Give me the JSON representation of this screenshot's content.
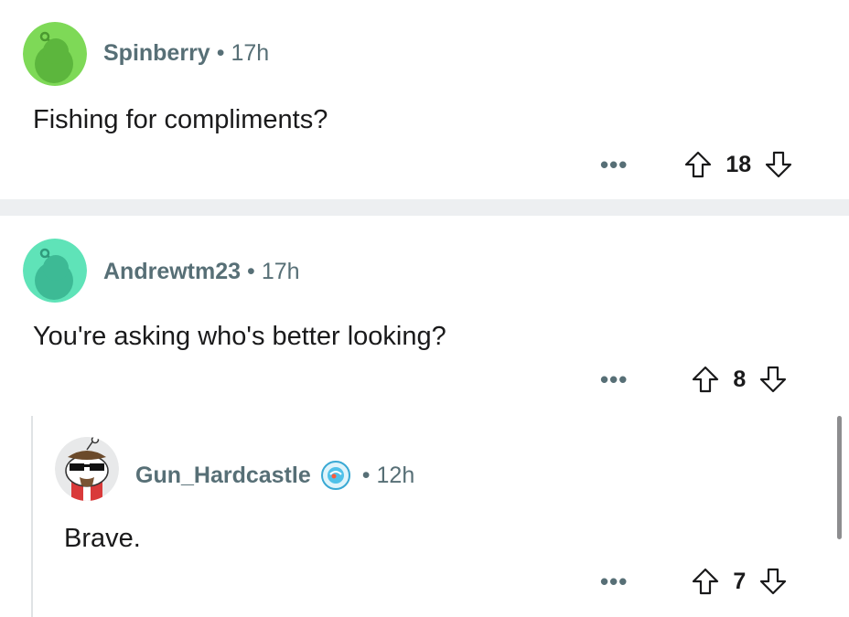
{
  "comments": [
    {
      "username": "Spinberry",
      "separator": "•",
      "time": "17h",
      "body": "Fishing for compliments?",
      "more": "•••",
      "score": "18",
      "avatar_color": "#7ed957"
    },
    {
      "username": "Andrewtm23",
      "separator": "•",
      "time": "17h",
      "body": "You're asking who's better looking?",
      "more": "•••",
      "score": "8",
      "avatar_color": "#5fe3b8"
    },
    {
      "username": "Gun_Hardcastle",
      "separator": "•",
      "time": "12h",
      "body": "Brave.",
      "more": "•••",
      "score": "7",
      "badge_color": "#4fc1e9"
    }
  ],
  "icons": {
    "upvote": "arrow-up-outline-icon",
    "downvote": "arrow-down-outline-icon",
    "more": "ellipsis-icon"
  }
}
